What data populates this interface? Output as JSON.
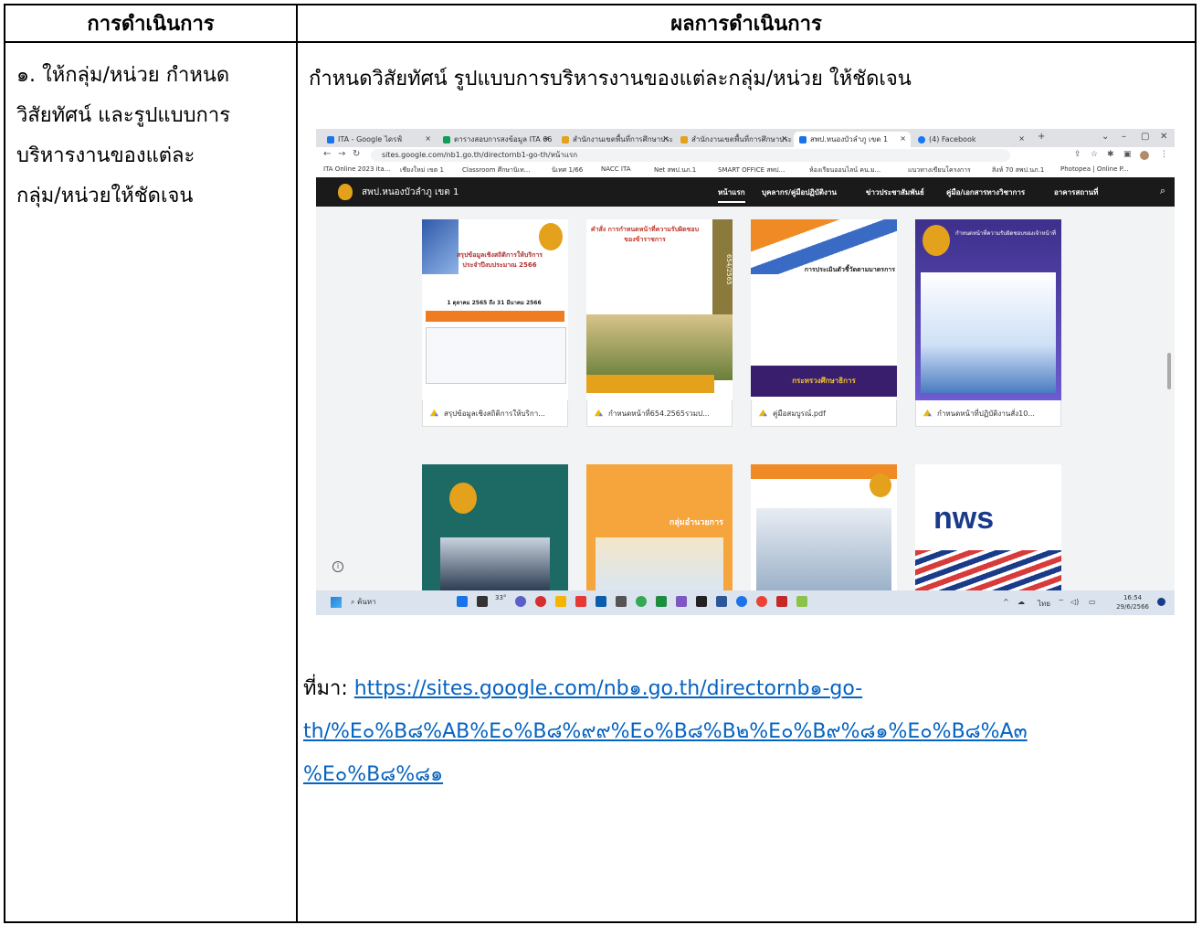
{
  "table": {
    "header_left": "การดำเนินการ",
    "header_right": "ผลการดำเนินการ",
    "step_lines": [
      "๑. ให้กลุ่ม/หน่วย กำหนด",
      "วิสัยทัศน์ และรูปแบบการ",
      "บริหารงานของแต่ละ",
      "กลุ่ม/หน่วยให้ชัดเจน"
    ],
    "result_title": "กำหนดวิสัยทัศน์ รูปแบบการบริหารงานของแต่ละกลุ่ม/หน่วย ให้ชัดเจน",
    "source_label": "ที่มา:",
    "source_link_lines": [
      "https://sites.google.com/nb๑.go.th/directornb๑-go-",
      "th/%E๐%B๘%AB%E๐%B๘%๙๙%E๐%B๘%B๒%E๐%B๙%๘๑%E๐%B๘%A๓",
      "%E๐%B๘%๘๑"
    ]
  },
  "browser": {
    "tabs": [
      {
        "label": "ITA - Google ไดรฟ์",
        "color": "#1a73e8"
      },
      {
        "label": "ตารางสอบการสงข้อมูล ITA 66",
        "color": "#0f9d58"
      },
      {
        "label": "สำนักงานเขตพื้นที่การศึกษาประ",
        "color": "#e4a21c"
      },
      {
        "label": "สำนักงานเขตพื้นที่การศึกษาประ",
        "color": "#e4a21c"
      },
      {
        "label": "สพป.หนองบัวลำภู เขต 1",
        "color": "#1a73e8"
      },
      {
        "label": "(4) Facebook",
        "color": "#1877f2"
      }
    ],
    "url": "sites.google.com/nb1.go.th/directornb1-go-th/หน้าแรก",
    "bookmarks": [
      "ITA Online 2023 ita...",
      "เชียงใหม่ เขต 1",
      "Classroom ศึกษานิเท...",
      "นิเทศ 1/66",
      "NACC ITA",
      "Net สพป.นภ.1",
      "SMART OFFICE สพป...",
      "ห้องเรียนออนไลน์ คน.ม...",
      "แนวทางเขียนโครงการ",
      "สิงห์ 70 สพป.นภ.1",
      "Photopea | Online P..."
    ]
  },
  "site": {
    "name": "สพป.หนองบัวลำภู เขต 1",
    "nav": [
      "หน้าแรก",
      "บุคลากร/คู่มือปฏิบัติงาน",
      "ข่าวประชาสัมพันธ์",
      "คู่มือ/เอกสารทางวิชาการ",
      "อาคารสถานที่"
    ],
    "files_row1": [
      "สรุปข้อมูลเชิงสถิติการให้บริกา...",
      "กำหนดหน้าที่654.2565รวมป...",
      "คู่มือสมบูรณ์.pdf",
      "กำหนดหน้าที่ปฏิบัติงานสั่ง10..."
    ],
    "thumb_texts": {
      "t1_title": "สรุปข้อมูลเชิงสถิติการให้บริการ ประจำปีงบประมาณ 2566",
      "t1_date": "1 ตุลาคม 2565 ถึง 31 มีนาคม 2566",
      "t2_title": "คำสั่ง การกำหนดหน้าที่ความรับผิดชอบ ของข้าราชการ",
      "t2_code": "654/2565",
      "t3_title": "การประเมินตัวชี้วัดตามมาตรการ",
      "t3_band": "กระทรวงศึกษาธิการ",
      "t4_title": "กำหนดหน้าที่ความรับผิดชอบของเจ้าหน้าที่",
      "t6_band": "กลุ่มอำนวยการ",
      "t8_brand": "nws"
    }
  },
  "taskbar": {
    "search": "ค้นหา",
    "weather": "33°",
    "lang": "ไทย",
    "time": "16:54",
    "date": "29/6/2566"
  }
}
